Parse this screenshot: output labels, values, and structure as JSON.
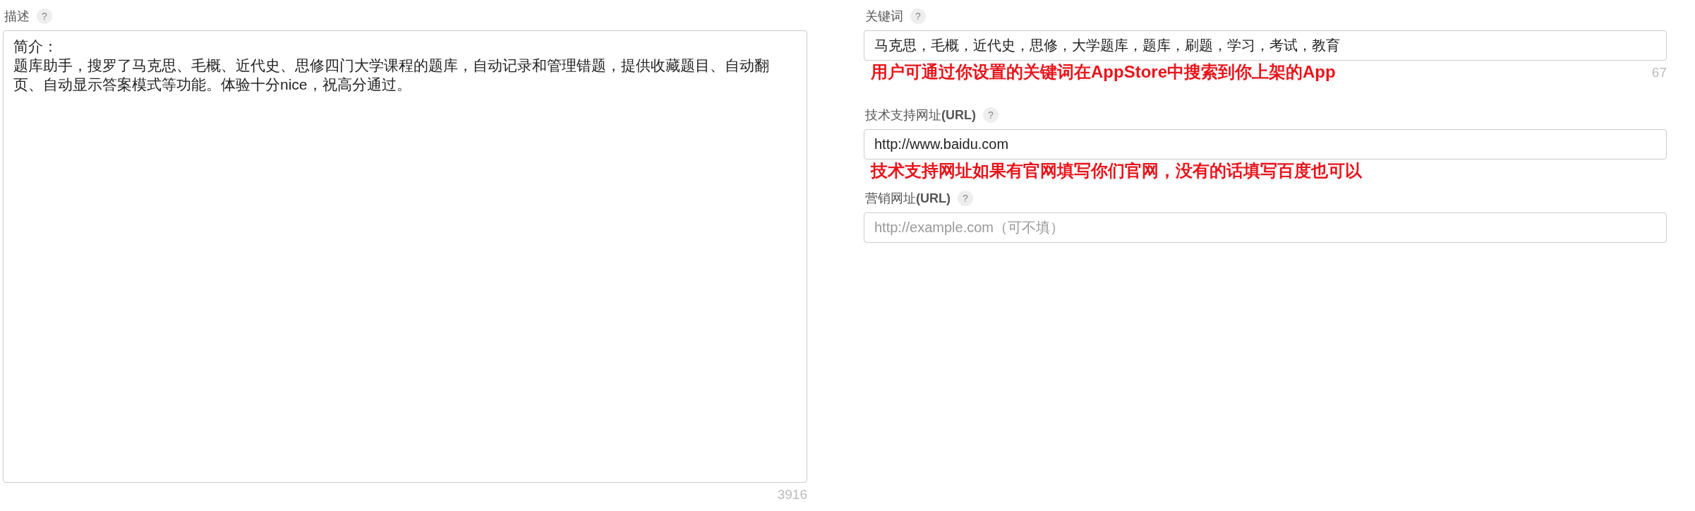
{
  "description": {
    "label": "描述",
    "help": "?",
    "title": "简介：",
    "text": "题库助手，搜罗了马克思、毛概、近代史、思修四门大学课程的题库，自动记录和管理错题，提供收藏题目、自动翻页、自动显示答案模式等功能。体验十分nice，祝高分通过。",
    "count": "3916"
  },
  "fields": [
    {
      "label": "关键词",
      "help": "?",
      "value": "马克思，毛概，近代史，思修，大学题库，题库，刷题，学习，考试，教育",
      "note": "用户可通过你设置的关键词在AppStore中搜索到你上架的App",
      "count": "67"
    },
    {
      "label": "技术支持网址**(URL)**",
      "help": "?",
      "value": "http://www.baidu.com",
      "note": "技术支持网址如果有官网填写你们官网，没有的话填写百度也可以"
    },
    {
      "label": "营销网址**(URL)**",
      "help": "?",
      "placeholder": "http://example.com（可不填）"
    }
  ]
}
